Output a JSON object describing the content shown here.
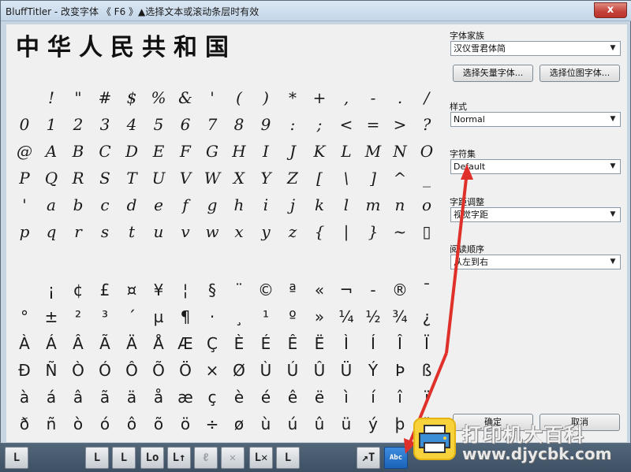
{
  "window": {
    "title": "BluffTitler - 改变字体  《 F6 》▲选择文本或滚动条层时有效",
    "close_glyph": "x"
  },
  "sample_text": "中华人民共和国",
  "glyph_rows_ascii": [
    [
      " ",
      "!",
      "\"",
      "#",
      "$",
      "%",
      "&",
      "'",
      "(",
      ")",
      "*",
      "+",
      ",",
      "-",
      ".",
      "/"
    ],
    [
      "0",
      "1",
      "2",
      "3",
      "4",
      "5",
      "6",
      "7",
      "8",
      "9",
      ":",
      ";",
      "<",
      "=",
      ">",
      "?"
    ],
    [
      "@",
      "A",
      "B",
      "C",
      "D",
      "E",
      "F",
      "G",
      "H",
      "I",
      "J",
      "K",
      "L",
      "M",
      "N",
      "O"
    ],
    [
      "P",
      "Q",
      "R",
      "S",
      "T",
      "U",
      "V",
      "W",
      "X",
      "Y",
      "Z",
      "[",
      "\\",
      "]",
      "^",
      "_"
    ],
    [
      "'",
      "a",
      "b",
      "c",
      "d",
      "e",
      "f",
      "g",
      "h",
      "i",
      "j",
      "k",
      "l",
      "m",
      "n",
      "o"
    ],
    [
      "p",
      "q",
      "r",
      "s",
      "t",
      "u",
      "v",
      "w",
      "x",
      "y",
      "z",
      "{",
      "|",
      "}",
      "~",
      "▯"
    ]
  ],
  "glyph_rows_latin1": [
    [
      " ",
      "¡",
      "¢",
      "£",
      "¤",
      "¥",
      "¦",
      "§",
      "¨",
      "©",
      "ª",
      "«",
      "¬",
      "-",
      "®",
      "¯"
    ],
    [
      "°",
      "±",
      "²",
      "³",
      "´",
      "µ",
      "¶",
      "·",
      "¸",
      "¹",
      "º",
      "»",
      "¼",
      "½",
      "¾",
      "¿"
    ],
    [
      "À",
      "Á",
      "Â",
      "Ã",
      "Ä",
      "Å",
      "Æ",
      "Ç",
      "È",
      "É",
      "Ê",
      "Ë",
      "Ì",
      "Í",
      "Î",
      "Ï"
    ],
    [
      "Ð",
      "Ñ",
      "Ò",
      "Ó",
      "Ô",
      "Õ",
      "Ö",
      "×",
      "Ø",
      "Ù",
      "Ú",
      "Û",
      "Ü",
      "Ý",
      "Þ",
      "ß"
    ],
    [
      "à",
      "á",
      "â",
      "ã",
      "ä",
      "å",
      "æ",
      "ç",
      "è",
      "é",
      "ê",
      "ë",
      "ì",
      "í",
      "î",
      "ï"
    ],
    [
      "ð",
      "ñ",
      "ò",
      "ó",
      "ô",
      "õ",
      "ö",
      "÷",
      "ø",
      "ù",
      "ú",
      "û",
      "ü",
      "ý",
      "þ",
      "ÿ"
    ]
  ],
  "panel": {
    "font_family_label": "字体家族",
    "font_family_value": "汉仪雪君体简",
    "vector_font_button": "选择矢量字体...",
    "bitmap_font_button": "选择位图字体...",
    "style_label": "样式",
    "style_value": "Normal",
    "charset_label": "字符集",
    "charset_value": "Default",
    "spacing_label": "字距调整",
    "spacing_value": "视觉字距",
    "reading_order_label": "阅读顺序",
    "reading_order_value": "从左到右",
    "ok_button": "确定",
    "cancel_button": "取消",
    "dropdown_arrow": "▼"
  },
  "toolbar": {
    "buttons": [
      "L",
      "L",
      "L",
      "Lo",
      "L↑",
      "ℓ",
      "✕",
      "L✕",
      "L",
      "↗T",
      "Abc"
    ]
  },
  "watermark": {
    "line1": "打印机大百科",
    "line2": "www.djycbk.com"
  },
  "colors": {
    "accent_active": "#1b62b8",
    "annotation_red": "#e0302a"
  }
}
